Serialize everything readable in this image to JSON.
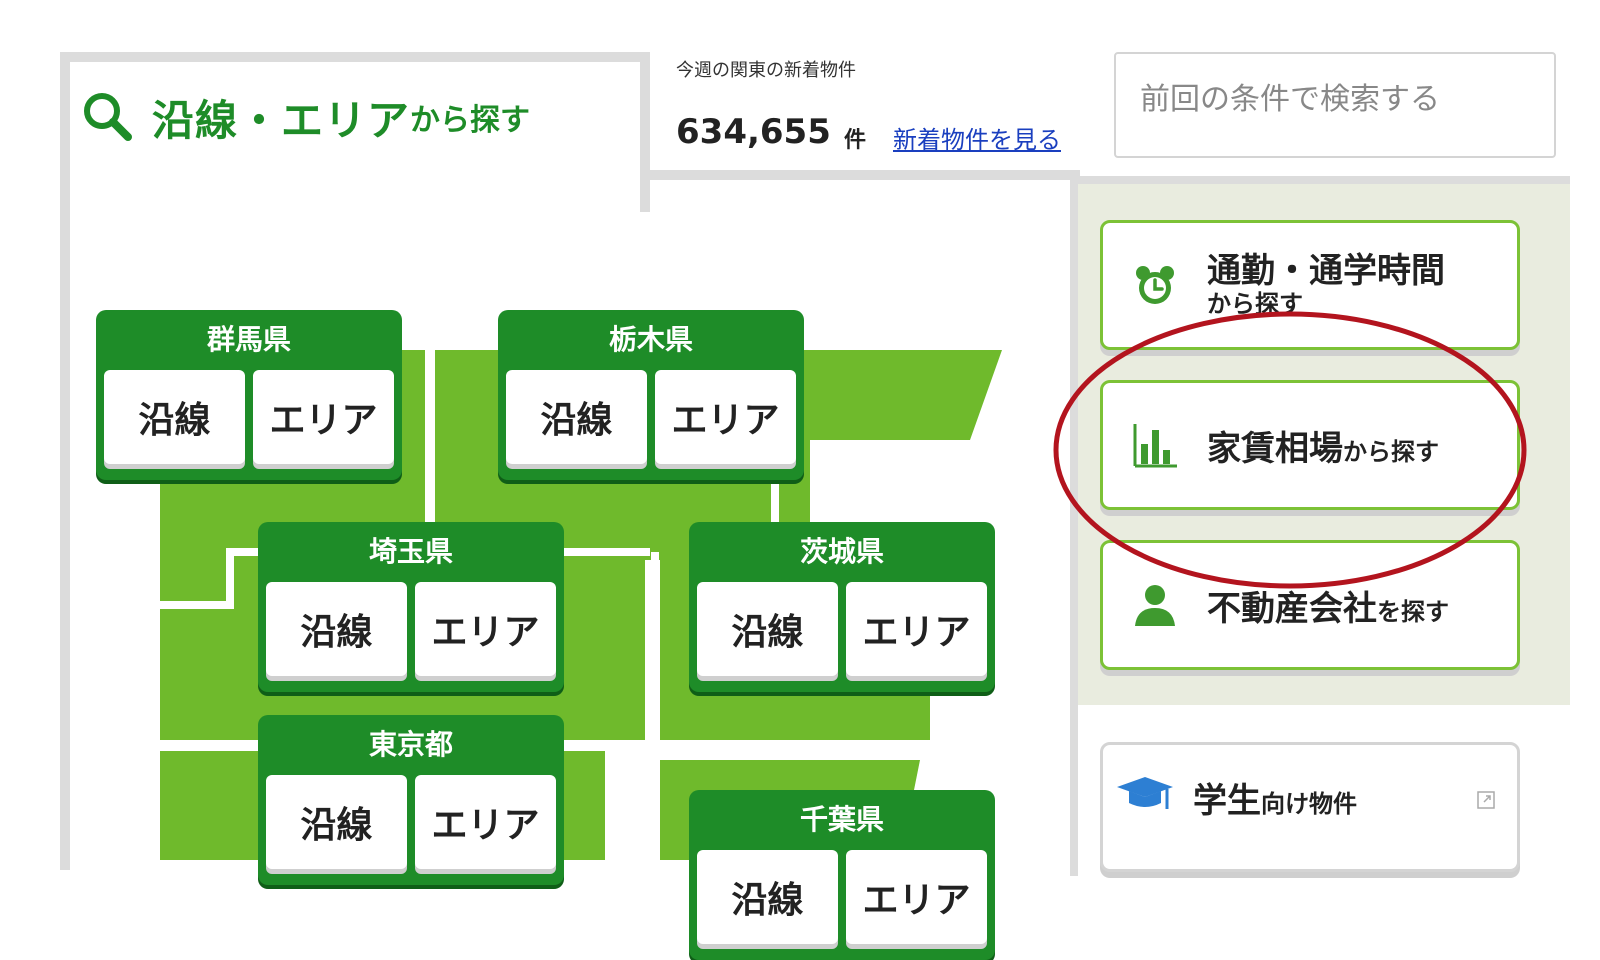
{
  "search_tab": {
    "title": "沿線・エリア",
    "title_suffix": "から探す",
    "icon": "search-icon"
  },
  "new_listings": {
    "label": "今週の関東の新着物件",
    "count": "634,655",
    "unit": "件",
    "link": "新着物件を見る"
  },
  "previous_search": {
    "label": "前回の条件で検索する"
  },
  "prefectures": [
    {
      "name": "群馬県",
      "line": "沿線",
      "area": "エリア"
    },
    {
      "name": "栃木県",
      "line": "沿線",
      "area": "エリア"
    },
    {
      "name": "埼玉県",
      "line": "沿線",
      "area": "エリア"
    },
    {
      "name": "茨城県",
      "line": "沿線",
      "area": "エリア"
    },
    {
      "name": "東京都",
      "line": "沿線",
      "area": "エリア"
    },
    {
      "name": "千葉県",
      "line": "沿線",
      "area": "エリア"
    }
  ],
  "side_buttons": {
    "commute": {
      "big": "通勤・通学時間",
      "small": "から探す",
      "icon": "alarm-clock-icon"
    },
    "rent": {
      "big": "家賃相場",
      "small": "から探す",
      "icon": "bar-chart-icon"
    },
    "agency": {
      "big": "不動産会社",
      "small": "を探す",
      "icon": "person-icon"
    },
    "student": {
      "big": "学生",
      "small": "向け物件",
      "icon": "graduation-cap-icon"
    }
  },
  "colors": {
    "brand_green": "#1e8c28",
    "map_green": "#6fba2c",
    "button_border": "#7cc236",
    "highlight_red": "#b3141e"
  }
}
